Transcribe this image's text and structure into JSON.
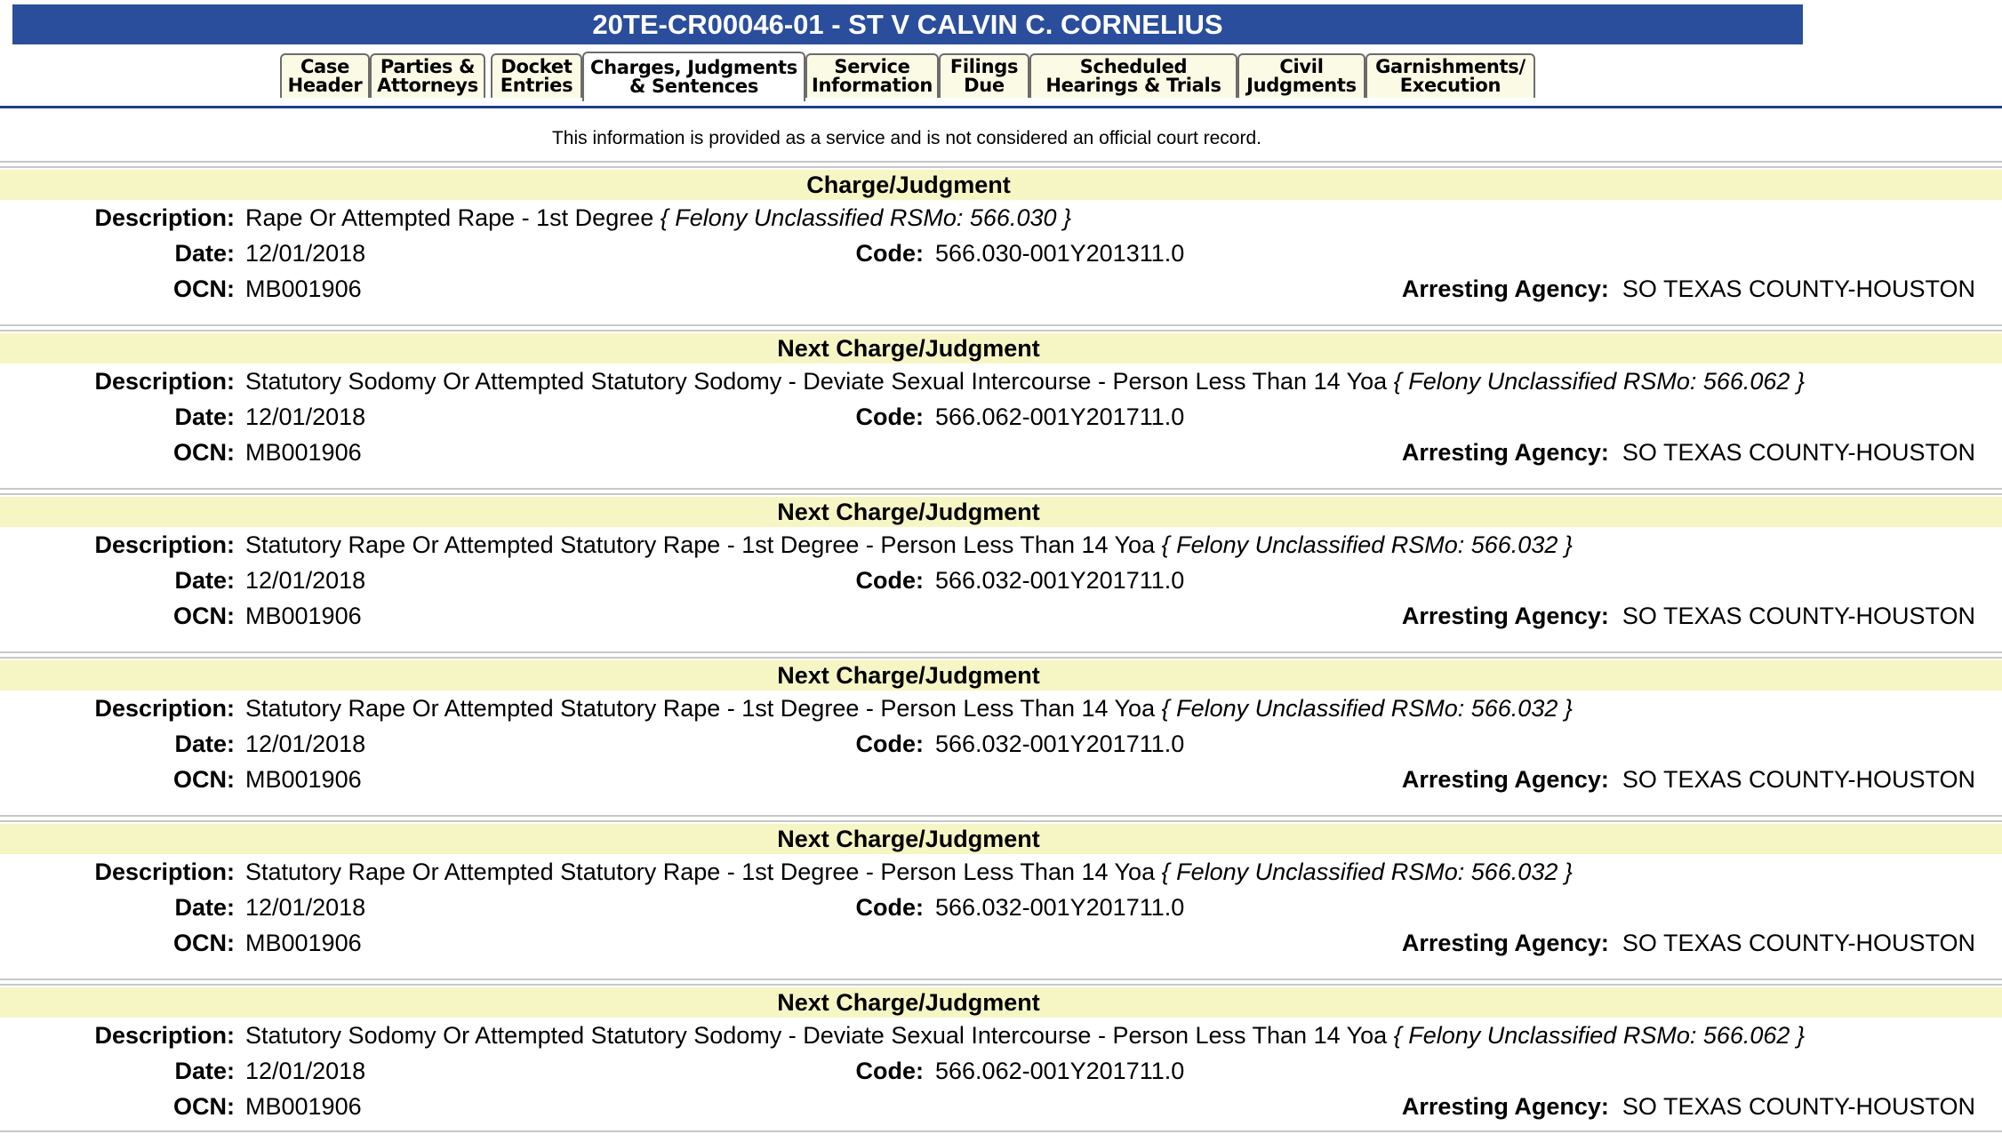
{
  "case_title": "20TE-CR00046-01 - ST V CALVIN C. CORNELIUS",
  "tabs": [
    {
      "line1": "Case",
      "line2": "Header"
    },
    {
      "line1": "Parties &",
      "line2": "Attorneys"
    },
    {
      "line1": "Docket",
      "line2": "Entries"
    },
    {
      "line1": "Charges, Judgments",
      "line2": "& Sentences"
    },
    {
      "line1": "Service",
      "line2": "Information"
    },
    {
      "line1": "Filings",
      "line2": "Due"
    },
    {
      "line1": "Scheduled",
      "line2": "Hearings & Trials"
    },
    {
      "line1": "Civil",
      "line2": "Judgments"
    },
    {
      "line1": "Garnishments/",
      "line2": "Execution"
    }
  ],
  "active_tab": "Charges, Judgments & Sentences",
  "notice": "This information is provided as a service and is not considered an official court record.",
  "labels": {
    "description": "Description:",
    "date": "Date:",
    "code": "Code:",
    "ocn": "OCN:",
    "arresting_agency": "Arresting Agency:"
  },
  "charges": [
    {
      "header": "Charge/Judgment",
      "description": "Rape Or Attempted Rape - 1st Degree",
      "statute": "{ Felony Unclassified RSMo: 566.030 }",
      "date": "12/01/2018",
      "code": "566.030-001Y201311.0",
      "ocn": "MB001906",
      "arresting_agency": "SO TEXAS COUNTY-HOUSTON"
    },
    {
      "header": "Next Charge/Judgment",
      "description": "Statutory Sodomy Or Attempted Statutory Sodomy - Deviate Sexual Intercourse - Person Less Than 14 Yoa",
      "statute": "{ Felony Unclassified RSMo: 566.062 }",
      "date": "12/01/2018",
      "code": "566.062-001Y201711.0",
      "ocn": "MB001906",
      "arresting_agency": "SO TEXAS COUNTY-HOUSTON"
    },
    {
      "header": "Next Charge/Judgment",
      "description": "Statutory Rape Or Attempted Statutory Rape - 1st Degree - Person Less Than 14 Yoa",
      "statute": "{ Felony Unclassified RSMo: 566.032 }",
      "date": "12/01/2018",
      "code": "566.032-001Y201711.0",
      "ocn": "MB001906",
      "arresting_agency": "SO TEXAS COUNTY-HOUSTON"
    },
    {
      "header": "Next Charge/Judgment",
      "description": "Statutory Rape Or Attempted Statutory Rape - 1st Degree - Person Less Than 14 Yoa",
      "statute": "{ Felony Unclassified RSMo: 566.032 }",
      "date": "12/01/2018",
      "code": "566.032-001Y201711.0",
      "ocn": "MB001906",
      "arresting_agency": "SO TEXAS COUNTY-HOUSTON"
    },
    {
      "header": "Next Charge/Judgment",
      "description": "Statutory Rape Or Attempted Statutory Rape - 1st Degree - Person Less Than 14 Yoa",
      "statute": "{ Felony Unclassified RSMo: 566.032 }",
      "date": "12/01/2018",
      "code": "566.032-001Y201711.0",
      "ocn": "MB001906",
      "arresting_agency": "SO TEXAS COUNTY-HOUSTON"
    },
    {
      "header": "Next Charge/Judgment",
      "description": "Statutory Sodomy Or Attempted Statutory Sodomy - Deviate Sexual Intercourse - Person Less Than 14 Yoa",
      "statute": "{ Felony Unclassified RSMo: 566.062 }",
      "date": "12/01/2018",
      "code": "566.062-001Y201711.0",
      "ocn": "MB001906",
      "arresting_agency": "SO TEXAS COUNTY-HOUSTON"
    }
  ]
}
